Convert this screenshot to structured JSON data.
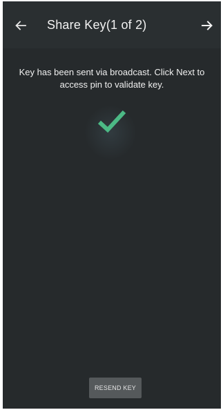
{
  "header": {
    "title": "Share Key(1 of 2)",
    "back_icon": "arrow-left-icon",
    "next_icon": "arrow-right-icon"
  },
  "content": {
    "message": "Key has been sent via broadcast. Click Next to access pin to validate key.",
    "status_icon": "checkmark-icon",
    "status_color": "#4cb985"
  },
  "footer": {
    "resend_label": "RESEND KEY"
  },
  "colors": {
    "background": "#262a2c",
    "button": "#55595b"
  }
}
